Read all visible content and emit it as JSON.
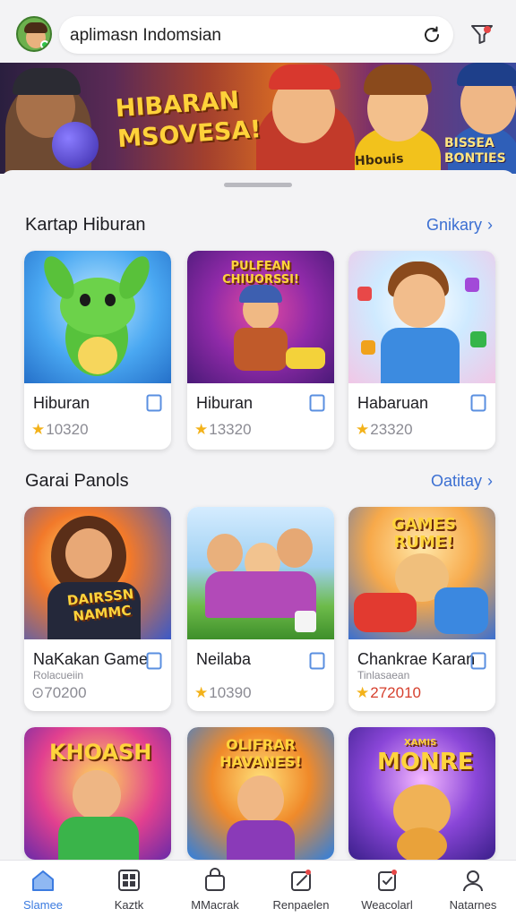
{
  "header": {
    "search_text": "aplimasn Indomsian",
    "avatar": "avatar-icon",
    "refresh_icon": "refresh-icon",
    "filter_icon": "filter-icon"
  },
  "banner": {
    "title_line1": "HIBARAN",
    "title_line2": "MSOVESA!",
    "side_line1": "BISSEA",
    "side_line2": "BONTIES",
    "mid_text": "Hbouis"
  },
  "sections": [
    {
      "title": "Kartap Hiburan",
      "link": "Gnikary",
      "cards": [
        {
          "name": "Hiburan",
          "rating": "10320",
          "star_color": "#f3b21a"
        },
        {
          "name": "Hiburan",
          "rating": "13320",
          "art_text": "PULFEAN CHIUORSSI!",
          "star_color": "#f3b21a"
        },
        {
          "name": "Habaruan",
          "rating": "23320",
          "star_color": "#f3b21a"
        }
      ]
    },
    {
      "title": "Garai Panols",
      "link": "Oatitay",
      "cards": [
        {
          "name": "NaKakan Game",
          "sub": "Rolacueiin",
          "rating": "70200",
          "art_text": "DAIRSSN NAMMC",
          "rating_icon": "clock-icon"
        },
        {
          "name": "Neilaba",
          "sub": "",
          "rating": "10390",
          "star_color": "#f3b21a"
        },
        {
          "name": "Chankrae Karan",
          "sub": "Tinlasaean",
          "rating": "272010",
          "art_text": "GAMES RUME!",
          "star_color": "#f3b21a"
        }
      ]
    },
    {
      "title": "",
      "cards": [
        {
          "art_text": "KHOASH"
        },
        {
          "art_text": "OLIFRAR HAVANES!"
        },
        {
          "art_text_top": "XAMIS",
          "art_text": "MONRE"
        }
      ]
    }
  ],
  "nav": {
    "items": [
      {
        "label": "Slamee",
        "icon": "home-icon",
        "active": true
      },
      {
        "label": "Kaztk",
        "icon": "grid-icon"
      },
      {
        "label": "MMacrak",
        "icon": "bag-icon"
      },
      {
        "label": "Renpaelen",
        "icon": "edit-icon"
      },
      {
        "label": "Weacolarl",
        "icon": "clipboard-icon"
      },
      {
        "label": "Natarnes",
        "icon": "person-icon"
      }
    ],
    "active_color": "#3b7be0"
  }
}
